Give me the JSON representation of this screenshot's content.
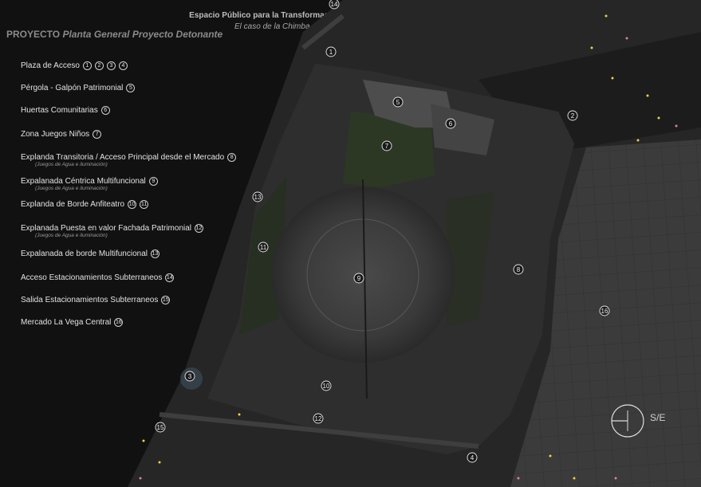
{
  "header": {
    "title": "Espacio Público para la Transformación de un Barrio en Ecobarrio",
    "subtitle": "El caso de la Chimba, sector La Vega Central",
    "project_prefix": "PROYECTO",
    "project_title": "Planta General Proyecto Detonante"
  },
  "legend": [
    {
      "label": "Plaza de Acceso",
      "nums": [
        "1",
        "2",
        "3",
        "4"
      ]
    },
    {
      "label": "Pérgola - Galpón Patrimonial",
      "nums": [
        "5"
      ]
    },
    {
      "label": "Huertas Comunitarias",
      "nums": [
        "6"
      ]
    },
    {
      "label": "Zona Juegos Niños",
      "nums": [
        "7"
      ]
    },
    {
      "label": "Explanda Transitoria / Acceso Principal desde el Mercado",
      "nums": [
        "8"
      ],
      "note": "(Juegos de Agua e iluminación)"
    },
    {
      "label": "Expalanada Céntrica Multifuncional",
      "nums": [
        "9"
      ],
      "note": "(Juegos de Agua e iluminación)"
    },
    {
      "label": "Explanda de Borde Anfiteatro",
      "nums": [
        "10",
        "11"
      ]
    },
    {
      "label": "Explanada Puesta en valor Fachada Patrimonial",
      "nums": [
        "12"
      ],
      "note": "(Juegos de Agua e iluminación)"
    },
    {
      "label": "Expalanada de borde Multifuncional",
      "nums": [
        "13"
      ]
    },
    {
      "label": "Acceso Estacionamientos Subterraneos",
      "nums": [
        "14"
      ]
    },
    {
      "label": "Salida Estacionamientos Subterraneos",
      "nums": [
        "15"
      ]
    },
    {
      "label": "Mercado La Vega Central",
      "nums": [
        "16"
      ]
    }
  ],
  "plan_markers": [
    "14",
    "1",
    "2",
    "5",
    "6",
    "7",
    "13",
    "11",
    "9",
    "8",
    "16",
    "3",
    "10",
    "12",
    "15",
    "4"
  ],
  "compass_label": "S/E",
  "colors": {
    "background": "#111111",
    "ground": "#2f2f2f",
    "block": "#4a4a4a",
    "green": "#3a4a2a"
  }
}
